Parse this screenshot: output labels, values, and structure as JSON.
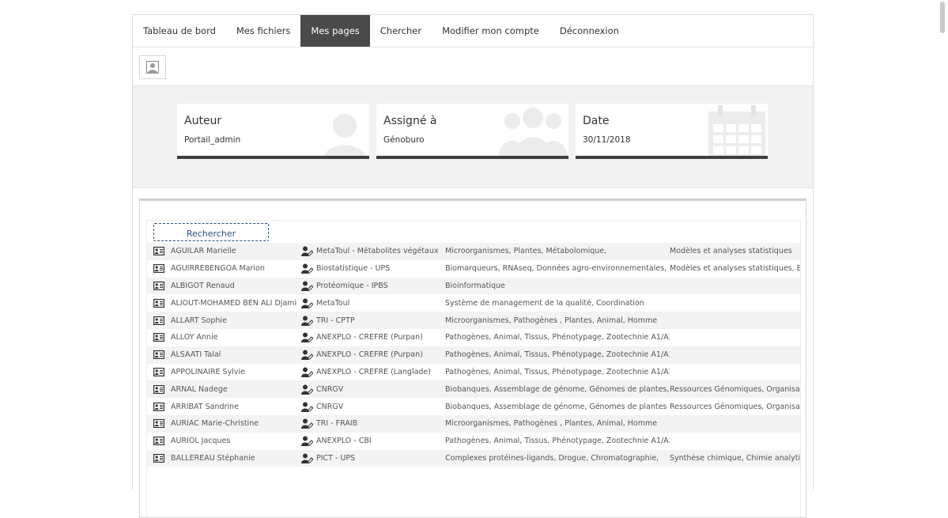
{
  "nav": {
    "tabs": [
      {
        "label": "Tableau de bord",
        "active": false
      },
      {
        "label": "Mes fichiers",
        "active": false
      },
      {
        "label": "Mes pages",
        "active": true
      },
      {
        "label": "Chercher",
        "active": false
      },
      {
        "label": "Modifier mon compte",
        "active": false
      },
      {
        "label": "Déconnexion",
        "active": false
      }
    ]
  },
  "info": {
    "author": {
      "title": "Auteur",
      "value": "Portail_admin",
      "icon": "person-icon"
    },
    "assigned": {
      "title": "Assigné à",
      "value": "Génoburo",
      "icon": "group-icon"
    },
    "date": {
      "title": "Date",
      "value": "30/11/2018",
      "icon": "calendar-icon"
    }
  },
  "search": {
    "label": "Rechercher"
  },
  "colors": {
    "active_tab": "#4a4a4a",
    "card_border": "#3e3e3e",
    "search_border": "#2a4f7a"
  },
  "table": {
    "rows": [
      {
        "name": "AGUILAR Marielle",
        "platform": "MetaToul - Métabolites végétaux",
        "domains": "Microorganismes, Plantes, Métabolomique,",
        "competences": "Modèles et analyses statistiques"
      },
      {
        "name": "AGUIRREBENGOA Marion",
        "platform": "Biostatistique - UPS",
        "domains": "Biomarqueurs, RNAseq, Données agro-environnementales,",
        "competences": "Modèles et analyses statistiques, Bioi"
      },
      {
        "name": "ALBIGOT Renaud",
        "platform": "Protéomique - IPBS",
        "domains": "Bioinformatique",
        "competences": ""
      },
      {
        "name": "ALIOUT-MOHAMED BEN ALI Djamila",
        "platform": "MetaToul",
        "domains": "Système de management de la qualité, Coordination",
        "competences": ""
      },
      {
        "name": "ALLART Sophie",
        "platform": "TRI - CPTP",
        "domains": "Microorganismes, Pathogènes , Plantes, Animal, Homme",
        "competences": ""
      },
      {
        "name": "ALLOY Annie",
        "platform": "ANEXPLO - CREFRE (Purpan)",
        "domains": "Pathogènes, Animal, Tissus, Phénotypage, Zootechnie A1/A2/A3",
        "competences": ""
      },
      {
        "name": "ALSAATI Talal",
        "platform": "ANEXPLO - CREFRE (Purpan)",
        "domains": "Pathogènes, Animal, Tissus, Phénotypage, Zootechnie A1/A2/A3",
        "competences": ""
      },
      {
        "name": "APPOLINAIRE Sylvie",
        "platform": "ANEXPLO - CREFRE (Langlade)",
        "domains": "Pathogènes, Animal, Tissus, Phénotypage, Zootechnie A1/A2/A3",
        "competences": ""
      },
      {
        "name": "ARNAL Nadege",
        "platform": "CNRGV",
        "domains": "Biobanques, Assemblage de génome, Génomes de plantes,",
        "competences": "Ressources Génomiques, Organisatio"
      },
      {
        "name": "ARRIBAT Sandrine",
        "platform": "CNRGV",
        "domains": "Biobanques, Assemblage de génome, Génomes de plantes",
        "competences": "Ressources Génomiques, Organisatio"
      },
      {
        "name": "AURIAC Marie-Christine",
        "platform": "TRI - FRAIB",
        "domains": "Microorganismes, Pathogènes , Plantes, Animal, Homme",
        "competences": ""
      },
      {
        "name": "AURIOL Jacques",
        "platform": "ANEXPLO - CBI",
        "domains": "Pathogènes, Animal, Tissus, Phénotypage, Zootechnie A1/A2/A3",
        "competences": ""
      },
      {
        "name": "BALLEREAU Stéphanie",
        "platform": "PICT - UPS",
        "domains": "Complexes protéines-ligands, Drogue, Chromatographie,",
        "competences": "Synthèse chimique, Chimie analytiqu"
      }
    ]
  }
}
